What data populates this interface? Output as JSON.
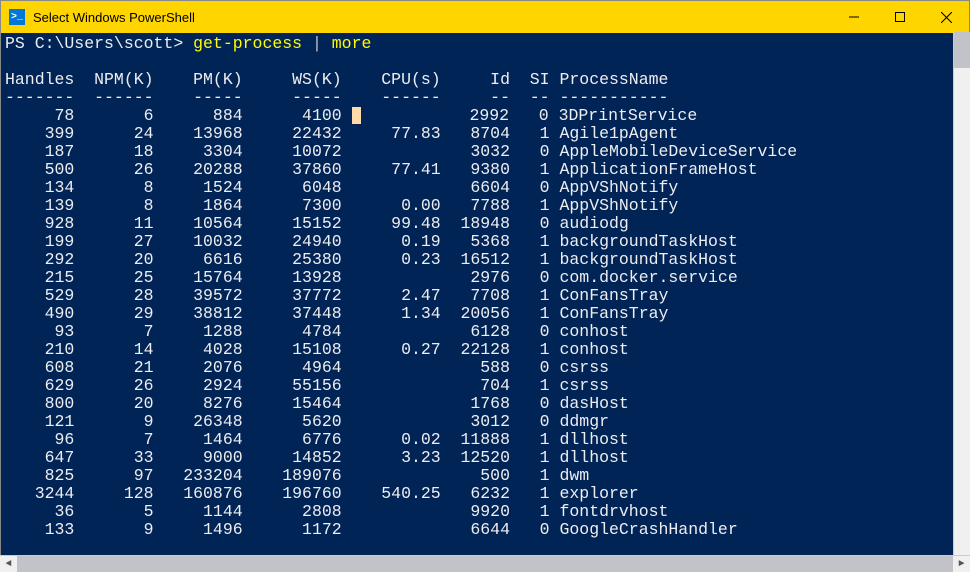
{
  "window": {
    "title": "Select Windows PowerShell",
    "icon_glyph": ">_"
  },
  "prompt": {
    "path": "PS C:\\Users\\scott> ",
    "cmd1": "get-process",
    "pipe": " | ",
    "cmd2": "more"
  },
  "columns": [
    "Handles",
    "NPM(K)",
    "PM(K)",
    "WS(K)",
    "CPU(s)",
    "Id",
    "SI",
    "ProcessName"
  ],
  "widths": [
    7,
    8,
    9,
    10,
    10,
    7,
    4,
    0
  ],
  "rows": [
    {
      "Handles": 78,
      "NPM": 6,
      "PM": 884,
      "WS": 4100,
      "CPU": "",
      "Id": 2992,
      "SI": 0,
      "Name": "3DPrintService",
      "cursor": true
    },
    {
      "Handles": 399,
      "NPM": 24,
      "PM": 13968,
      "WS": 22432,
      "CPU": "77.83",
      "Id": 8704,
      "SI": 1,
      "Name": "Agile1pAgent"
    },
    {
      "Handles": 187,
      "NPM": 18,
      "PM": 3304,
      "WS": 10072,
      "CPU": "",
      "Id": 3032,
      "SI": 0,
      "Name": "AppleMobileDeviceService"
    },
    {
      "Handles": 500,
      "NPM": 26,
      "PM": 20288,
      "WS": 37860,
      "CPU": "77.41",
      "Id": 9380,
      "SI": 1,
      "Name": "ApplicationFrameHost"
    },
    {
      "Handles": 134,
      "NPM": 8,
      "PM": 1524,
      "WS": 6048,
      "CPU": "",
      "Id": 6604,
      "SI": 0,
      "Name": "AppVShNotify"
    },
    {
      "Handles": 139,
      "NPM": 8,
      "PM": 1864,
      "WS": 7300,
      "CPU": "0.00",
      "Id": 7788,
      "SI": 1,
      "Name": "AppVShNotify"
    },
    {
      "Handles": 928,
      "NPM": 11,
      "PM": 10564,
      "WS": 15152,
      "CPU": "99.48",
      "Id": 18948,
      "SI": 0,
      "Name": "audiodg"
    },
    {
      "Handles": 199,
      "NPM": 27,
      "PM": 10032,
      "WS": 24940,
      "CPU": "0.19",
      "Id": 5368,
      "SI": 1,
      "Name": "backgroundTaskHost"
    },
    {
      "Handles": 292,
      "NPM": 20,
      "PM": 6616,
      "WS": 25380,
      "CPU": "0.23",
      "Id": 16512,
      "SI": 1,
      "Name": "backgroundTaskHost"
    },
    {
      "Handles": 215,
      "NPM": 25,
      "PM": 15764,
      "WS": 13928,
      "CPU": "",
      "Id": 2976,
      "SI": 0,
      "Name": "com.docker.service"
    },
    {
      "Handles": 529,
      "NPM": 28,
      "PM": 39572,
      "WS": 37772,
      "CPU": "2.47",
      "Id": 7708,
      "SI": 1,
      "Name": "ConFansTray"
    },
    {
      "Handles": 490,
      "NPM": 29,
      "PM": 38812,
      "WS": 37448,
      "CPU": "1.34",
      "Id": 20056,
      "SI": 1,
      "Name": "ConFansTray"
    },
    {
      "Handles": 93,
      "NPM": 7,
      "PM": 1288,
      "WS": 4784,
      "CPU": "",
      "Id": 6128,
      "SI": 0,
      "Name": "conhost"
    },
    {
      "Handles": 210,
      "NPM": 14,
      "PM": 4028,
      "WS": 15108,
      "CPU": "0.27",
      "Id": 22128,
      "SI": 1,
      "Name": "conhost"
    },
    {
      "Handles": 608,
      "NPM": 21,
      "PM": 2076,
      "WS": 4964,
      "CPU": "",
      "Id": 588,
      "SI": 0,
      "Name": "csrss"
    },
    {
      "Handles": 629,
      "NPM": 26,
      "PM": 2924,
      "WS": 55156,
      "CPU": "",
      "Id": 704,
      "SI": 1,
      "Name": "csrss"
    },
    {
      "Handles": 800,
      "NPM": 20,
      "PM": 8276,
      "WS": 15464,
      "CPU": "",
      "Id": 1768,
      "SI": 0,
      "Name": "dasHost"
    },
    {
      "Handles": 121,
      "NPM": 9,
      "PM": 26348,
      "WS": 5620,
      "CPU": "",
      "Id": 3012,
      "SI": 0,
      "Name": "ddmgr"
    },
    {
      "Handles": 96,
      "NPM": 7,
      "PM": 1464,
      "WS": 6776,
      "CPU": "0.02",
      "Id": 11888,
      "SI": 1,
      "Name": "dllhost"
    },
    {
      "Handles": 647,
      "NPM": 33,
      "PM": 9000,
      "WS": 14852,
      "CPU": "3.23",
      "Id": 12520,
      "SI": 1,
      "Name": "dllhost"
    },
    {
      "Handles": 825,
      "NPM": 97,
      "PM": 233204,
      "WS": 189076,
      "CPU": "",
      "Id": 500,
      "SI": 1,
      "Name": "dwm"
    },
    {
      "Handles": 3244,
      "NPM": 128,
      "PM": 160876,
      "WS": 196760,
      "CPU": "540.25",
      "Id": 6232,
      "SI": 1,
      "Name": "explorer"
    },
    {
      "Handles": 36,
      "NPM": 5,
      "PM": 1144,
      "WS": 2808,
      "CPU": "",
      "Id": 9920,
      "SI": 1,
      "Name": "fontdrvhost"
    },
    {
      "Handles": 133,
      "NPM": 9,
      "PM": 1496,
      "WS": 1172,
      "CPU": "",
      "Id": 6644,
      "SI": 0,
      "Name": "GoogleCrashHandler"
    }
  ]
}
